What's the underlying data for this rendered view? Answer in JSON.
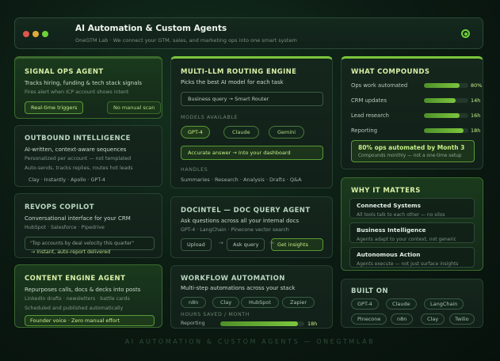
{
  "window": {
    "title": "AI Automation & Custom Agents",
    "subtitle": "OneGTM Lab · We connect your GTM, sales, and marketing ops into one smart system",
    "colors": {
      "red": "#e0564a",
      "yellow": "#e2a93b",
      "green": "#6fd13a"
    }
  },
  "signal_ops": {
    "title": "SIGNAL OPS AGENT",
    "main": "Tracks hiring, funding & tech stack signals",
    "sub": "Fires alert when ICP account shows intent",
    "tags": [
      "Real-time triggers",
      "No manual scan"
    ]
  },
  "outbound": {
    "title": "OUTBOUND INTELLIGENCE",
    "main": "AI-written, context-aware sequences",
    "sub1": "Personalized per account — not templated",
    "sub2": "Auto-sends, tracks replies, routes hot leads",
    "tools": "Clay · Instantly · Apollo · GPT-4"
  },
  "revops": {
    "title": "REVOPS COPILOT",
    "main": "Conversational interface for your CRM",
    "sub": "HubSpot · Salesforce · Pipedrive",
    "query": "\"Top accounts by deal velocity this quarter\"",
    "result": "→ Instant, auto-report delivered"
  },
  "content": {
    "title": "CONTENT ENGINE AGENT",
    "main": "Repurposes calls, docs & decks into posts",
    "sub1": "LinkedIn drafts · newsletters · battle cards",
    "sub2": "Scheduled and published automatically",
    "tag": "Founder voice · Zero manual effort"
  },
  "routing": {
    "title": "MULTI-LLM ROUTING ENGINE",
    "main": "Picks the best AI model for each task",
    "query_box": "Business query → Smart Router",
    "models_label": "MODELS AVAILABLE",
    "models": [
      "GPT-4",
      "Claude",
      "Gemini"
    ],
    "answer_box": "Accurate answer → Into your dashboard",
    "handles_label": "HANDLES",
    "handles": "Summaries · Research · Analysis · Drafts · Q&A"
  },
  "docintel": {
    "title": "DOCINTEL — DOC QUERY AGENT",
    "main": "Ask questions across all your internal docs",
    "sub": "GPT-4 · LangChain · Pinecone vector search",
    "steps": [
      "Upload",
      "Ask query",
      "Get insights"
    ]
  },
  "workflow": {
    "title": "WORKFLOW AUTOMATION",
    "main": "Multi-step automations across your stack",
    "tools": [
      "n8n",
      "Clay",
      "HubSpot",
      "Zapier"
    ],
    "hours_label": "HOURS SAVED / MONTH",
    "bar_label": "Reporting",
    "bar_fraction": 0.92,
    "bar_value": "18h"
  },
  "compounds": {
    "title": "WHAT COMPOUNDS",
    "rows": [
      {
        "label": "Ops work automated",
        "value": "80%",
        "fraction": 0.8
      },
      {
        "label": "CRM updates",
        "value": "14h",
        "fraction": 0.72
      },
      {
        "label": "Lead research",
        "value": "16h",
        "fraction": 0.8
      },
      {
        "label": "Reporting",
        "value": "18h",
        "fraction": 0.9
      }
    ],
    "highlight_title": "80% ops automated by Month 3",
    "highlight_sub": "Compounds monthly — not a one-time setup"
  },
  "why": {
    "title": "WHY IT MATTERS",
    "items": [
      {
        "title": "Connected Systems",
        "desc": "All tools talk to each other — no silos"
      },
      {
        "title": "Business Intelligence",
        "desc": "Agents adapt to your context, not generic"
      },
      {
        "title": "Autonomous Action",
        "desc": "Agents execute — not just surface insights"
      }
    ]
  },
  "built_on": {
    "title": "BUILT ON",
    "row1": [
      "GPT-4",
      "Claude",
      "LangChain"
    ],
    "row2": [
      "Pinecone",
      "n8n",
      "Clay",
      "Twilio"
    ]
  },
  "footer": "AI AUTOMATION & CUSTOM AGENTS — ONEGTMLAB"
}
